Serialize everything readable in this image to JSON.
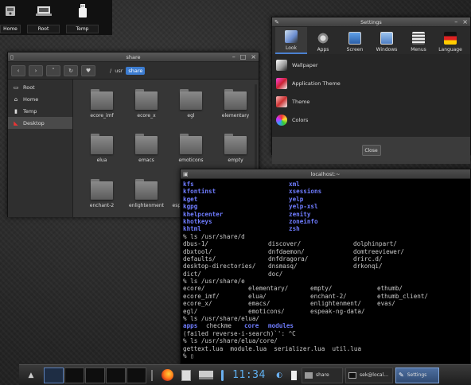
{
  "desktop_shelf": {
    "items": [
      {
        "label": "Home",
        "icon": "home-drive-icon"
      },
      {
        "label": "Root",
        "icon": "root-drive-icon"
      },
      {
        "label": "Temp",
        "icon": "temp-usb-icon"
      }
    ]
  },
  "file_manager": {
    "title": "share",
    "breadcrumb": [
      "/",
      "usr",
      "share"
    ],
    "sidebar": [
      {
        "label": "Root",
        "icon": "root-drive-icon"
      },
      {
        "label": "Home",
        "icon": "home-icon"
      },
      {
        "label": "Temp",
        "icon": "usb-icon"
      },
      {
        "label": "Desktop",
        "icon": "desktop-icon"
      }
    ],
    "folders": [
      "ecore_imf",
      "ecore_x",
      "egl",
      "elementary",
      "elua",
      "emacs",
      "emoticons",
      "empty",
      "enchant-2",
      "enlightenment",
      "espeak-ng-data"
    ]
  },
  "settings": {
    "title": "Settings",
    "tabs": [
      "Look",
      "Apps",
      "Screen",
      "Windows",
      "Menus",
      "Language"
    ],
    "items": [
      "Wallpaper",
      "Application Theme",
      "Theme",
      "Colors"
    ],
    "close_label": "Close"
  },
  "terminal": {
    "title": "localhost:~",
    "lines": [
      [
        {
          "t": "kfs",
          "c": "blue"
        },
        {
          "t": "xml",
          "c": "blue",
          "col": 133
        }
      ],
      [
        {
          "t": "kfontinst",
          "c": "blue"
        },
        {
          "t": "xsessions",
          "c": "blue",
          "col": 133
        }
      ],
      [
        {
          "t": "kget",
          "c": "blue"
        },
        {
          "t": "yelp",
          "c": "blue",
          "col": 133
        }
      ],
      [
        {
          "t": "kgpg",
          "c": "blue"
        },
        {
          "t": "yelp-xsl",
          "c": "blue",
          "col": 133
        }
      ],
      [
        {
          "t": "khelpcenter",
          "c": "blue"
        },
        {
          "t": "zenity",
          "c": "blue",
          "col": 133
        }
      ],
      [
        {
          "t": "khotkeys",
          "c": "blue"
        },
        {
          "t": "zoneinfo",
          "c": "blue",
          "col": 133
        }
      ],
      [
        {
          "t": "khtml",
          "c": "blue"
        },
        {
          "t": "zsh",
          "c": "blue",
          "col": 133
        }
      ],
      [
        {
          "t": "% ls /usr/share/d"
        }
      ],
      [
        {
          "t": "dbus-1/"
        },
        {
          "t": "discover/",
          "col": 107
        },
        {
          "t": "dolphinpart/",
          "col": 214
        }
      ],
      [
        {
          "t": "dbxtool/"
        },
        {
          "t": "dnfdaemon/",
          "col": 107
        },
        {
          "t": "domtreeviewer/",
          "col": 214
        }
      ],
      [
        {
          "t": "defaults/"
        },
        {
          "t": "dnfdragora/",
          "col": 107
        },
        {
          "t": "drirc.d/",
          "col": 214
        }
      ],
      [
        {
          "t": "desktop-directories/"
        },
        {
          "t": "dnsmasq/",
          "col": 107
        },
        {
          "t": "drkonqi/",
          "col": 214
        }
      ],
      [
        {
          "t": "dict/"
        },
        {
          "t": "doc/",
          "col": 107
        }
      ],
      [
        {
          "t": "% ls /usr/share/e"
        }
      ],
      [
        {
          "t": "ecore/"
        },
        {
          "t": "elementary/",
          "col": 82
        },
        {
          "t": "empty/",
          "col": 160
        },
        {
          "t": "ethumb/",
          "col": 244
        }
      ],
      [
        {
          "t": "ecore_imf/"
        },
        {
          "t": "elua/",
          "col": 82
        },
        {
          "t": "enchant-2/",
          "col": 160
        },
        {
          "t": "ethumb_client/",
          "col": 244
        }
      ],
      [
        {
          "t": "ecore_x/"
        },
        {
          "t": "emacs/",
          "col": 82
        },
        {
          "t": "enlightenment/",
          "col": 160
        },
        {
          "t": "evas/",
          "col": 244
        }
      ],
      [
        {
          "t": "egl/"
        },
        {
          "t": "emoticons/",
          "col": 82
        },
        {
          "t": "espeak-ng-data/",
          "col": 160
        }
      ],
      [
        {
          "t": "% ls /usr/share/elua/"
        }
      ],
      [
        {
          "t": "apps",
          "c": "blue"
        },
        {
          "t": "checkme",
          "col": 29
        },
        {
          "t": "core",
          "c": "blue",
          "col": 77
        },
        {
          "t": "modules",
          "c": "blue",
          "col": 107
        }
      ],
      [
        {
          "t": "(failed reverse-i-search)`': ^C"
        }
      ],
      [
        {
          "t": "% ls /usr/share/elua/core/"
        }
      ],
      [
        {
          "t": "gettext.lua  module.lua  serializer.lua  util.lua"
        }
      ],
      [
        {
          "t": "% ▯"
        }
      ]
    ]
  },
  "taskbar": {
    "clock": "11:34",
    "tasks": [
      {
        "label": "share",
        "icon": "folder-icon"
      },
      {
        "label": "sek@local...",
        "icon": "terminal-icon"
      },
      {
        "label": "Settings",
        "icon": "wrench-icon"
      }
    ]
  }
}
